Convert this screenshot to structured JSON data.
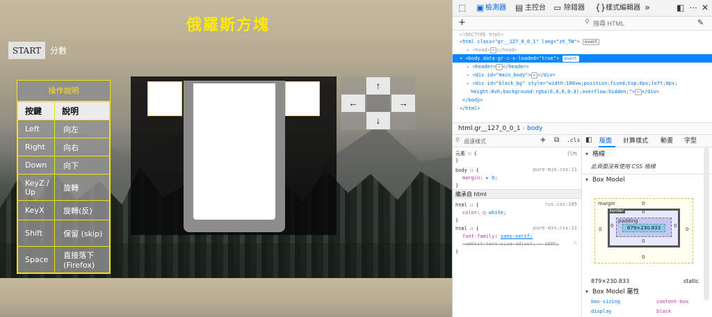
{
  "game": {
    "title": "俄羅斯方塊",
    "start_label": "START",
    "score_label": "分數",
    "instructions": {
      "caption": "操作說明",
      "headers": [
        "按鍵",
        "說明"
      ],
      "rows": [
        {
          "key": "Left",
          "desc": "向左"
        },
        {
          "key": "Right",
          "desc": "向右"
        },
        {
          "key": "Down",
          "desc": "向下"
        },
        {
          "key": "KeyZ / Up",
          "desc": "旋轉"
        },
        {
          "key": "KeyX",
          "desc": "旋轉(反)"
        },
        {
          "key": "Shift",
          "desc": "保留 (skip)"
        },
        {
          "key": "Space",
          "desc": "直接落下 (Firefox)"
        }
      ]
    },
    "dpad": {
      "up": "↑",
      "left": "←",
      "right": "→",
      "down": "↓"
    },
    "colors": {
      "title": "#ffea00",
      "table_border": "#f2e600"
    }
  },
  "devtools": {
    "tabs": {
      "inspector": "檢測器",
      "console": "主控台",
      "debugger": "除錯器",
      "style_editor": "樣式編輯器",
      "more": "»"
    },
    "search_placeholder": "搜尋 HTML",
    "markup": {
      "doctype": "<!DOCTYPE html>",
      "html_open": "<html class=\"gr__127_0_0_1\" lang=\"zh_TW\">",
      "head": "<head>",
      "head_close": "</head>",
      "body_open": "<body data-gr-c-s-loaded=\"true\">",
      "header": "<header>",
      "header_close": "</header>",
      "div_main": "<div id=\"main_body\">",
      "div_close": "</div>",
      "div_blackbg": "<div id=\"black_bg\" style=\"width:100vw;position:fixed;top:0px;left:0px;",
      "div_blackbg_cont": "height:0vh;background:rgba(0,0,0,0.3);overflow:hidden;\">",
      "body_close": "</body>",
      "html_close": "</html>",
      "event_badge": "event",
      "ellipsis": "⋯"
    },
    "breadcrumbs": [
      "html.gr__127_0_0_1",
      "body"
    ],
    "rules": {
      "filter_placeholder": "過濾樣式",
      "cls_label": ".cls",
      "element": "元素",
      "element_rule": "{",
      "inline_label": "行內",
      "body_selector": "body",
      "body_src": "pure-min.css:11",
      "margin_prop": "margin",
      "margin_val": "0;",
      "inherited_head": "繼承自 html",
      "html_selector": "html",
      "html_src1": "rus.css:105",
      "color_prop": "color",
      "color_val": "white;",
      "html_src2": "pure-min.css:11",
      "font_prop": "font-family",
      "font_val": "sans-serif;",
      "webkit_prop": "-webkit-text-size-adjust",
      "webkit_val": "100%;"
    },
    "layout": {
      "tabs": [
        "版面",
        "計算樣式",
        "動畫",
        "字型"
      ],
      "grid_head": "格線",
      "grid_msg": "此頁面沒有使用 CSS 格線",
      "box_model_head": "Box Model",
      "margin_label": "margin",
      "border_label": "border",
      "padding_label": "padding",
      "content_size": "879×230.833",
      "zero": "0",
      "dims": "879×230.833",
      "position": "static",
      "props_head": "Box Model 屬性",
      "props": [
        {
          "name": "box-sizing",
          "value": "content-box"
        },
        {
          "name": "display",
          "value": "block"
        }
      ]
    }
  }
}
